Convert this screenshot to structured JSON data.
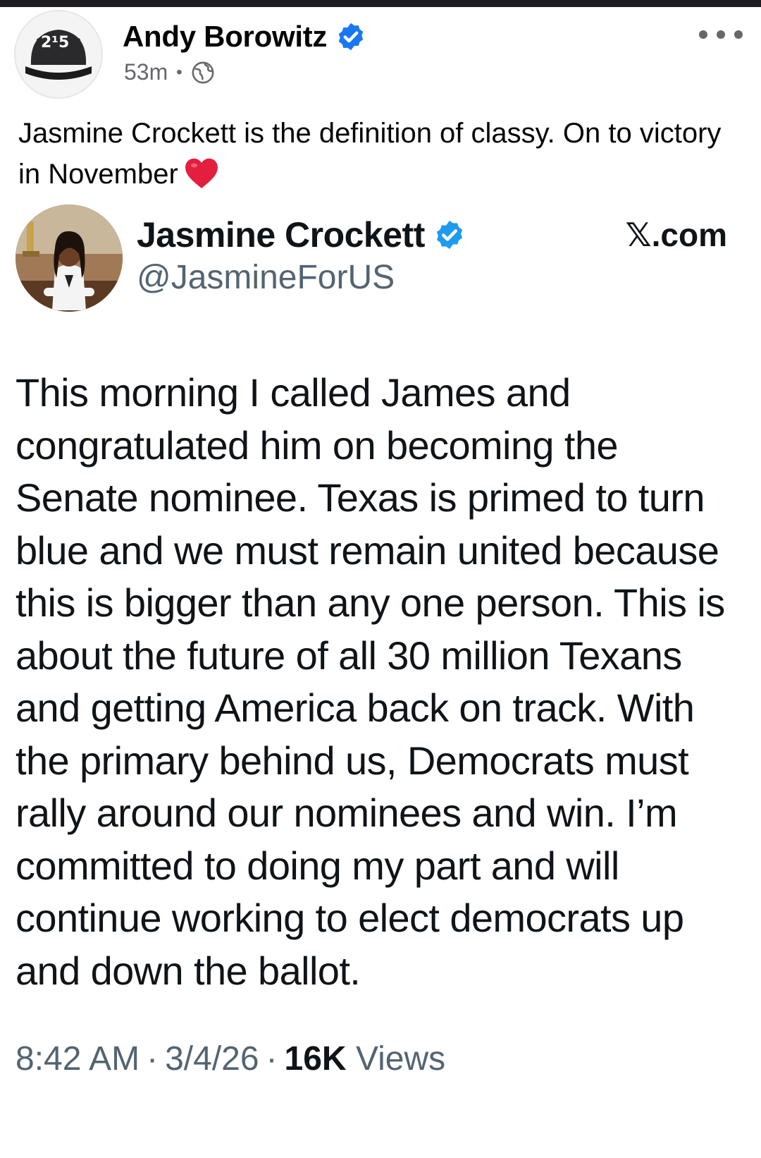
{
  "post": {
    "author_name": "Andy Borowitz",
    "avatar_text": "2¹5",
    "time": "53m",
    "meta_separator": "•",
    "audience_icon": "globe-icon",
    "caption": "Jasmine Crockett is the definition of classy. On to victory in November",
    "caption_emoji": "red-heart-icon",
    "more_icon": "more-options-icon"
  },
  "tweet": {
    "name": "Jasmine Crockett",
    "handle": "@JasmineForUS",
    "source": "𝕏.com",
    "body": "This morning I called James and congratulated him on becoming the Senate nominee. Texas is primed to turn blue and we must remain united because this is bigger than any one person. This is about the future of all 30 million Texans and getting America back on track. With the primary behind us, Democrats must rally around our nominees and win. I’m committed to doing my part and will continue working to elect democrats up and down the ballot.",
    "time": "8:42 AM",
    "date": "3/4/26",
    "separator": "·",
    "views_count": "16K",
    "views_label": "Views"
  },
  "colors": {
    "verified_blue": "#1d9bf0",
    "fb_verified_blue": "#1877f2",
    "secondary_text": "#65676b",
    "tweet_secondary": "#536471",
    "heart_red": "#e0245e"
  }
}
